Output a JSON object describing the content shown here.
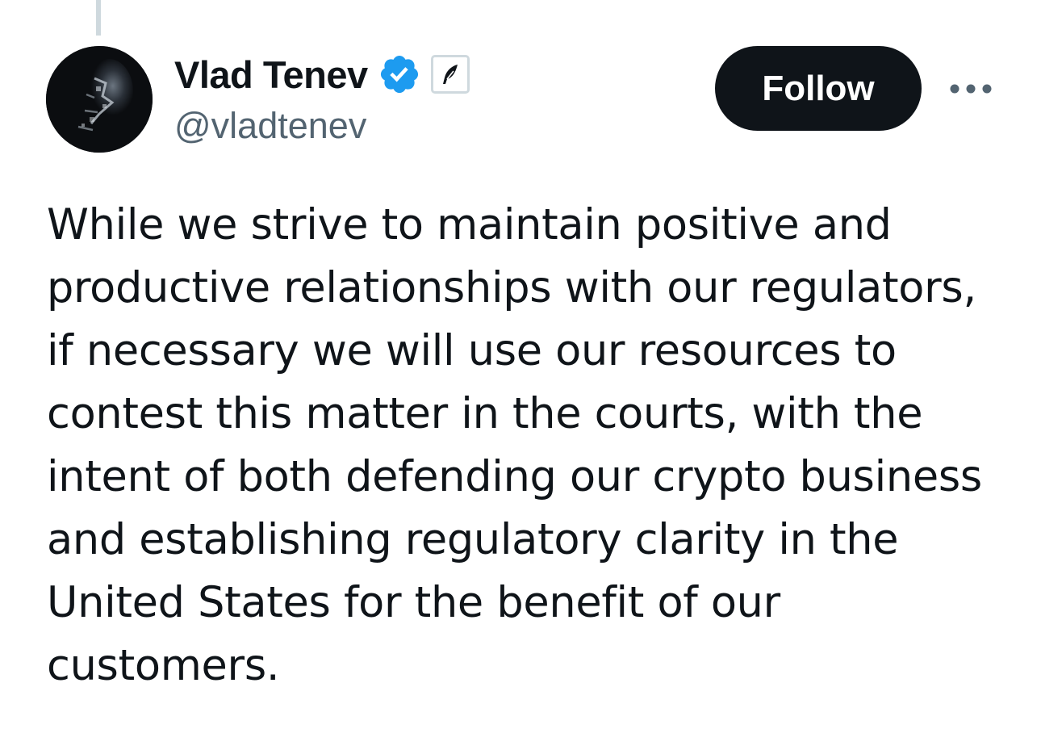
{
  "tweet": {
    "author": {
      "display_name": "Vlad Tenev",
      "handle": "@vladtenev",
      "verified_color": "#1d9bf0",
      "avatar_icon": "profile-photo-monochrome",
      "affiliate_icon": "robinhood-feather-icon"
    },
    "follow_label": "Follow",
    "more_icon": "ellipsis-icon",
    "text_lines": [
      "While we strive to maintain positive and",
      "productive relationships with our regulators,",
      "if necessary we will use our resources to",
      "contest this matter in the courts, with the",
      "intent of both defending our crypto business",
      "and establishing regulatory clarity in the",
      "United States for the benefit of our",
      "customers."
    ]
  }
}
